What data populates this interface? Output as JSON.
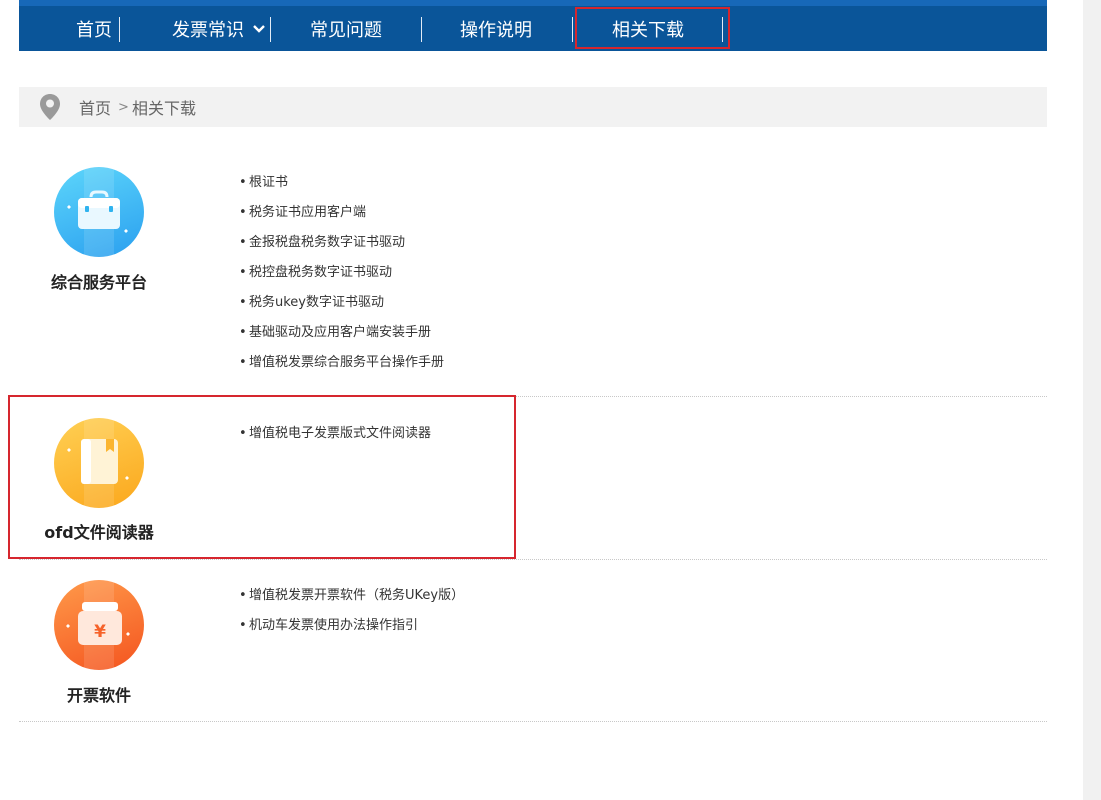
{
  "nav": {
    "items": [
      {
        "label": "首页"
      },
      {
        "label": "发票常识"
      },
      {
        "label": "常见问题"
      },
      {
        "label": "操作说明"
      },
      {
        "label": "相关下载"
      }
    ]
  },
  "breadcrumb": {
    "home": "首页",
    "separator": ">",
    "current": "相关下载"
  },
  "sections": [
    {
      "title": "综合服务平台",
      "icon": "briefcase-icon",
      "color": "#2fb3ef",
      "links": [
        "根证书",
        "税务证书应用客户端",
        "金报税盘税务数字证书驱动",
        "税控盘税务数字证书驱动",
        "税务ukey数字证书驱动",
        "基础驱动及应用客户端安装手册",
        "增值税发票综合服务平台操作手册"
      ]
    },
    {
      "title": "ofd文件阅读器",
      "icon": "book-icon",
      "color": "#fbb52f",
      "links": [
        "增值税电子发票版式文件阅读器"
      ]
    },
    {
      "title": "开票软件",
      "icon": "invoice-icon",
      "color": "#f6622a",
      "links": [
        "增值税发票开票软件（税务UKey版）",
        "机动车发票使用办法操作指引"
      ]
    }
  ],
  "colors": {
    "nav_bg": "#0a5599",
    "highlight": "#d6262e",
    "breadcrumb_bg": "#f2f2f2"
  }
}
